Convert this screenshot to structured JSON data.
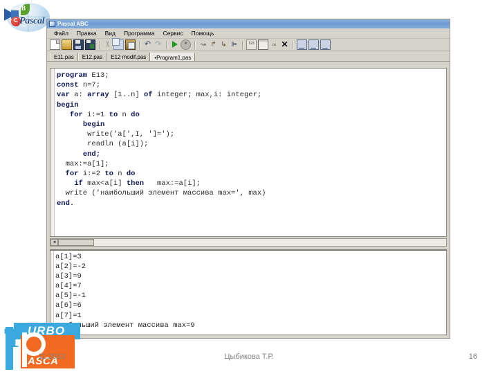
{
  "slide": {
    "brand_logo": {
      "name": "pascal-globe-logo",
      "text": "Pascal",
      "leaf_letter": "B",
      "ball_letter": "C"
    },
    "turbo_logo": {
      "top_word": "URBO",
      "t_letter": "T",
      "p_letter": "P",
      "bottom_word": "ASCA"
    }
  },
  "window": {
    "title": "Pascal ABC",
    "menu": [
      "Файл",
      "Правка",
      "Вид",
      "Программа",
      "Сервис",
      "Помощь"
    ],
    "toolbar": [
      {
        "name": "new-file-icon",
        "title": "Создать"
      },
      {
        "name": "open-file-icon",
        "title": "Открыть"
      },
      {
        "name": "save-file-icon",
        "title": "Сохранить"
      },
      {
        "name": "save-all-icon",
        "title": "Сохранить все"
      },
      {
        "name": "cut-icon",
        "title": "Вырезать"
      },
      {
        "name": "copy-icon",
        "title": "Копировать"
      },
      {
        "name": "paste-icon",
        "title": "Вставить"
      },
      {
        "name": "undo-icon",
        "title": "Отменить"
      },
      {
        "name": "redo-icon",
        "title": "Вернуть"
      },
      {
        "name": "run-icon",
        "title": "Выполнить"
      },
      {
        "name": "stop-icon",
        "title": "Стоп"
      },
      {
        "name": "step-over-icon",
        "title": "Шаг"
      },
      {
        "name": "step-into-icon",
        "title": "Войти"
      },
      {
        "name": "step-out-icon",
        "title": "Выйти"
      },
      {
        "name": "breakpoint-icon",
        "title": "Точка останова"
      },
      {
        "name": "watch-values-icon",
        "title": "Значения"
      },
      {
        "name": "window-icon",
        "title": "Окно"
      },
      {
        "name": "info-icon",
        "title": "Информация"
      },
      {
        "name": "close-icon",
        "title": "Закрыть"
      },
      {
        "name": "bookmark1-icon",
        "title": "Закладка 1"
      },
      {
        "name": "bookmark2-icon",
        "title": "Закладка 2"
      },
      {
        "name": "bookmark3-icon",
        "title": "Закладка 3"
      }
    ],
    "tabs": [
      {
        "label": "E11.pas",
        "active": false
      },
      {
        "label": "E12.pas",
        "active": false
      },
      {
        "label": "E12 modif.pas",
        "active": false
      },
      {
        "label": "•Program1.pas",
        "active": true
      }
    ],
    "editor": {
      "lines": [
        [
          {
            "t": "program ",
            "k": true
          },
          {
            "t": "E13;",
            "k": false
          }
        ],
        [
          {
            "t": "const ",
            "k": true
          },
          {
            "t": "n=7;",
            "k": false
          }
        ],
        [
          {
            "t": "var ",
            "k": true
          },
          {
            "t": "a: ",
            "k": false
          },
          {
            "t": "array ",
            "k": true
          },
          {
            "t": "[1..n] ",
            "k": false
          },
          {
            "t": "of ",
            "k": true
          },
          {
            "t": "integer; max,i: integer;",
            "k": false
          }
        ],
        [
          {
            "t": "begin",
            "k": true
          }
        ],
        [
          {
            "t": "   ",
            "k": false
          },
          {
            "t": "for ",
            "k": true
          },
          {
            "t": "i:=1 ",
            "k": false
          },
          {
            "t": "to ",
            "k": true
          },
          {
            "t": "n ",
            "k": false
          },
          {
            "t": "do",
            "k": true
          }
        ],
        [
          {
            "t": "      ",
            "k": false
          },
          {
            "t": "begin",
            "k": true
          }
        ],
        [
          {
            "t": "       write('a[',I, ']=');",
            "k": false
          }
        ],
        [
          {
            "t": "       readln (a[i]);",
            "k": false
          }
        ],
        [
          {
            "t": "      ",
            "k": false
          },
          {
            "t": "end;",
            "k": true
          }
        ],
        [
          {
            "t": "  max:=a[1];",
            "k": false
          }
        ],
        [
          {
            "t": "  ",
            "k": false
          },
          {
            "t": "for ",
            "k": true
          },
          {
            "t": "i:=2 ",
            "k": false
          },
          {
            "t": "to ",
            "k": true
          },
          {
            "t": "n ",
            "k": false
          },
          {
            "t": "do",
            "k": true
          }
        ],
        [
          {
            "t": "    ",
            "k": false
          },
          {
            "t": "if ",
            "k": true
          },
          {
            "t": "max<a[i] ",
            "k": false
          },
          {
            "t": "then ",
            "k": true
          },
          {
            "t": "  max:=a[i];",
            "k": false
          }
        ],
        [
          {
            "t": "  write ('наибольший элемент массива max=', max)",
            "k": false
          }
        ],
        [
          {
            "t": "end.",
            "k": true
          }
        ]
      ],
      "scrollbar": {
        "left_arrow": "◄"
      }
    },
    "console": {
      "lines": [
        "a[1]=3",
        "a[2]=-2",
        "a[3]=9",
        "a[4]=7",
        "a[5]=-1",
        "a[6]=6",
        "a[7]=1",
        "наибольший элемент массива max=9"
      ]
    }
  },
  "footer": {
    "date": "11.2013",
    "author": "Цыбикова Т.Р.",
    "page": "16"
  },
  "colors": {
    "titlebar": "#6e9bd3",
    "window_face": "#d6d3cb",
    "keyword": "#101a5a",
    "turbo_blue": "#3aa9dd",
    "turbo_orange": "#f26a21",
    "footer_text": "#808080"
  }
}
